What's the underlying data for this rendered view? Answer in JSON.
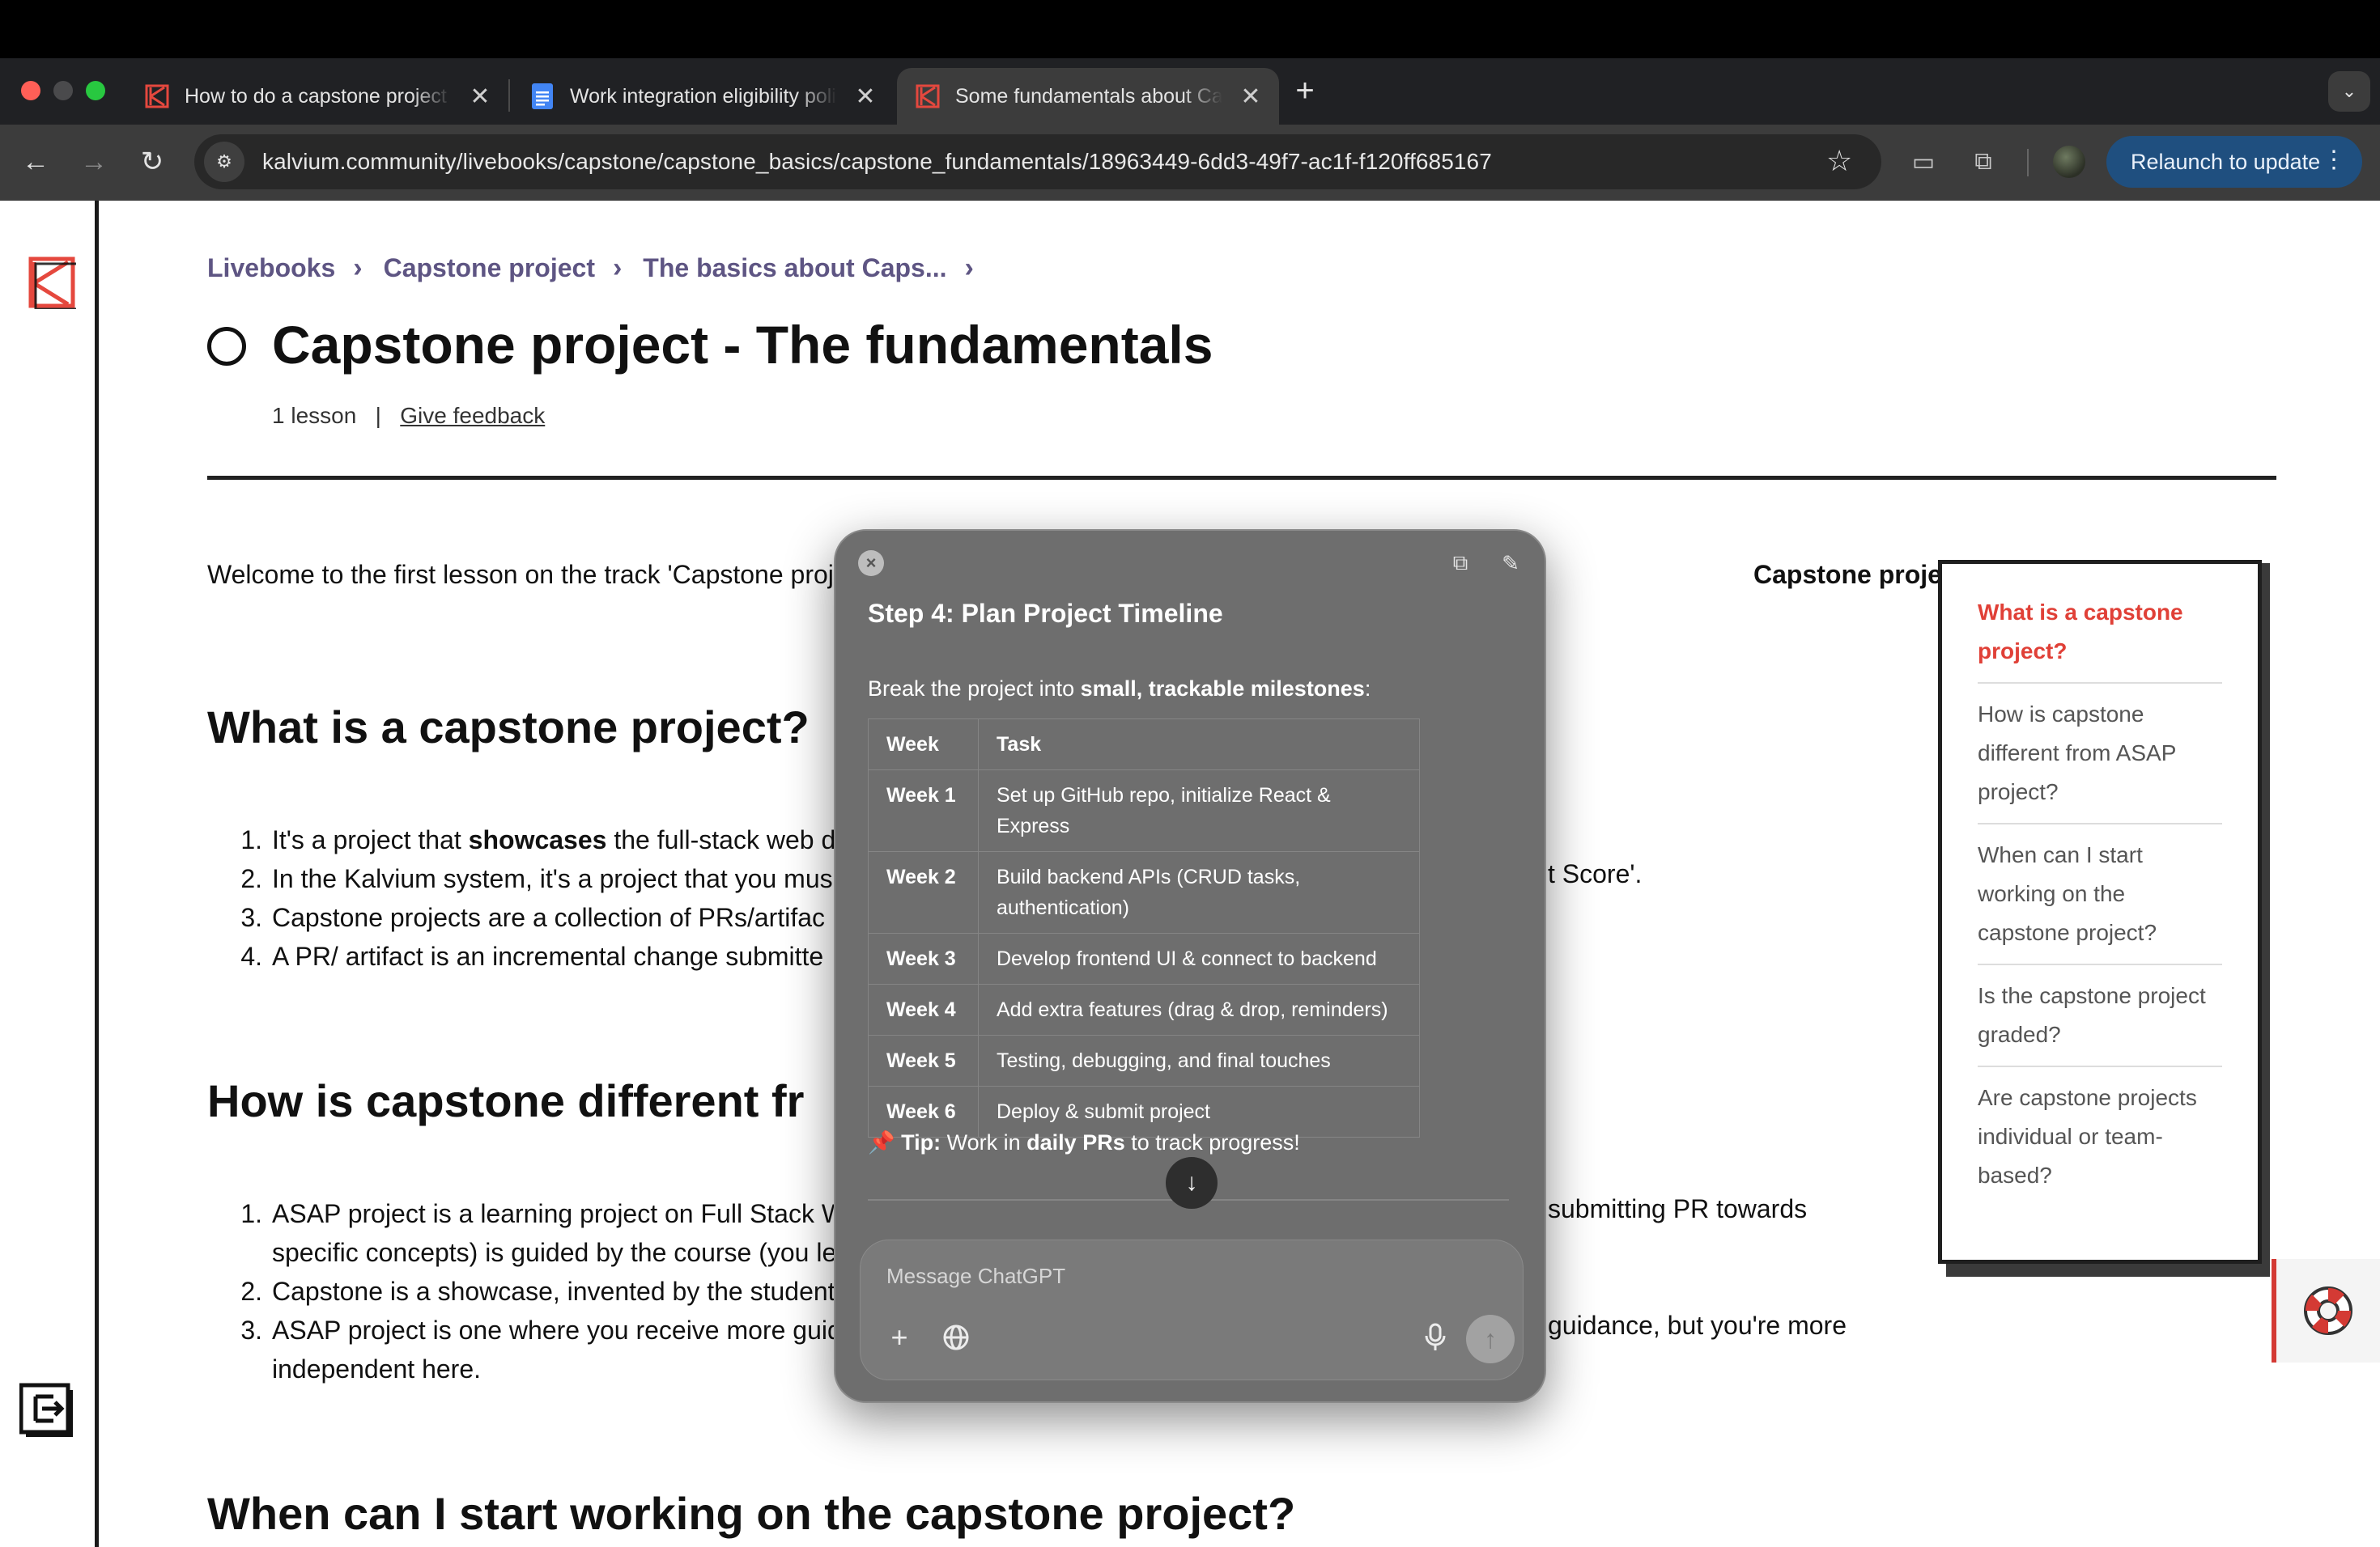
{
  "browser": {
    "tabs": [
      {
        "title": "How to do a capstone project",
        "close": "✕",
        "active": false
      },
      {
        "title": "Work integration eligibility policy",
        "close": "✕",
        "active": false
      },
      {
        "title": "Some fundamentals about Capstone",
        "close": "✕",
        "active": true
      }
    ],
    "new_tab": "+",
    "tab_search": "⌄",
    "url": "kalvium.community/livebooks/capstone/capstone_basics/capstone_fundamentals/18963449-6dd3-49f7-ac1f-f120ff685167",
    "relaunch_label": "Relaunch to update",
    "relaunch_dots": "⋮",
    "icons": {
      "back": "←",
      "forward": "→",
      "reload": "↻",
      "site_info": "⚙",
      "star": "☆",
      "cast": "▭",
      "extensions": "⧉"
    }
  },
  "page": {
    "breadcrumb": [
      "Livebooks",
      "Capstone project",
      "The basics about Caps..."
    ],
    "breadcrumb_chevron": "›",
    "title": "Capstone project - The fundamentals",
    "meta_lessons": "1 lesson",
    "meta_sep": "|",
    "meta_feedback": "Give feedback",
    "intro_left": "Welcome to the first lesson on the track 'Capstone proj",
    "intro_right": "Capstone project?",
    "intro_right_end": ".",
    "sections": [
      {
        "heading": "What is a capstone project?",
        "items": [
          {
            "num": "1.",
            "pre": "It's a project that ",
            "bold": "showcases",
            "post": " the full-stack web de"
          },
          {
            "num": "2.",
            "text": "In the Kalvium system, it's a project that you mus"
          },
          {
            "num": "3.",
            "text": "Capstone projects are a collection of PRs/artifac"
          },
          {
            "num": "4.",
            "text": "A PR/ artifact is an incremental change submitte"
          }
        ],
        "fragment_right": "t Score'."
      },
      {
        "heading": "How is capstone different fr",
        "items": [
          {
            "num": "1.",
            "text": "ASAP project is a learning project on Full Stack W",
            "line2": "specific concepts) is guided by the course (you le"
          },
          {
            "num": "2.",
            "text": "Capstone is a showcase, invented by the student"
          },
          {
            "num": "3.",
            "text": "ASAP project is one where you receive more guid",
            "line2": "independent here."
          }
        ],
        "fragment_right_1": "submitting PR towards",
        "fragment_right_3": "guidance, but you're more"
      },
      {
        "heading": "When can I start working on the capstone project?"
      }
    ]
  },
  "toc": [
    {
      "label": "What is a capstone project?",
      "active": true
    },
    {
      "label": "How is capstone different from ASAP project?",
      "active": false
    },
    {
      "label": "When can I start working on the capstone project?",
      "active": false
    },
    {
      "label": "Is the capstone project graded?",
      "active": false
    },
    {
      "label": "Are capstone projects individual or team-based?",
      "active": false
    }
  ],
  "chatgpt": {
    "step_title": "Step 4: Plan Project Timeline",
    "intro_pre": "Break the project into ",
    "intro_bold": "small, trackable milestones",
    "intro_post": ":",
    "table_headers": [
      "Week",
      "Task"
    ],
    "table_rows": [
      {
        "week": "Week 1",
        "task": "Set up GitHub repo, initialize React & Express"
      },
      {
        "week": "Week 2",
        "task": "Build backend APIs (CRUD tasks, authentication)"
      },
      {
        "week": "Week 3",
        "task": "Develop frontend UI & connect to backend"
      },
      {
        "week": "Week 4",
        "task": "Add extra features (drag & drop, reminders)"
      },
      {
        "week": "Week 5",
        "task": "Testing, debugging, and final touches"
      },
      {
        "week": "Week 6",
        "task": "Deploy & submit project"
      }
    ],
    "tip_pin": "📌",
    "tip_label": "Tip:",
    "tip_pre": " Work in ",
    "tip_bold": "daily PRs",
    "tip_post": " to track progress!",
    "scroll_down": "↓",
    "input_placeholder": "Message ChatGPT",
    "composer_icons": {
      "attach": "+",
      "search": "🌐",
      "mic": "🎙",
      "send": "↑"
    },
    "header_icons": {
      "close": "×",
      "popout": "⧉",
      "compose": "✎"
    }
  },
  "colors": {
    "accent_red": "#e04037",
    "breadcrumb": "#5e5583",
    "relaunch": "#1f4f7f"
  }
}
